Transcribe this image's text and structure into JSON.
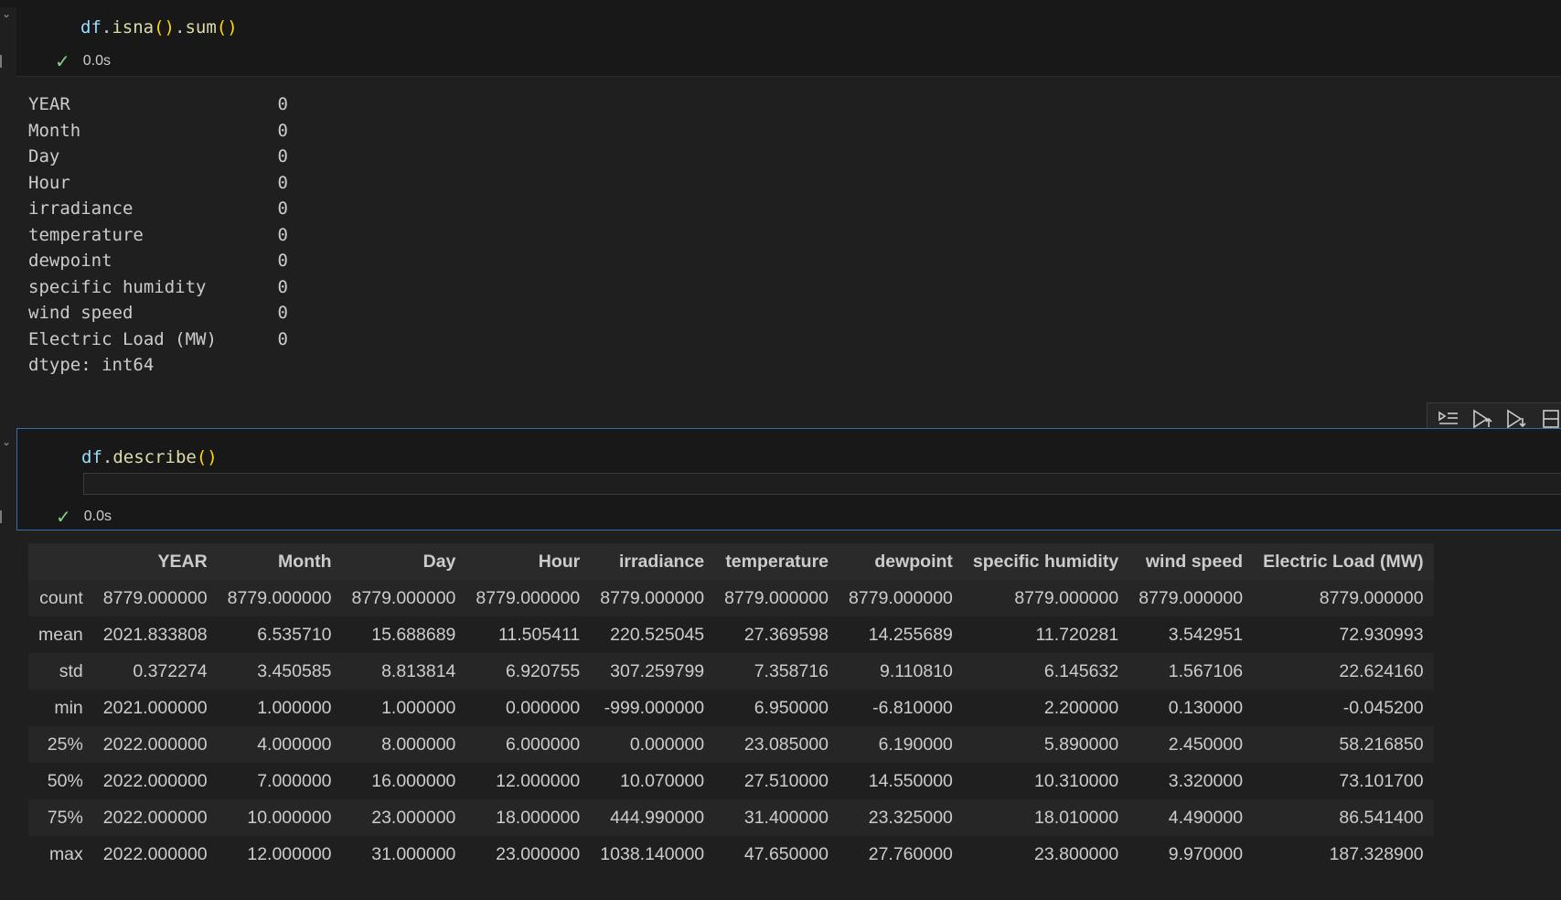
{
  "cell1": {
    "code": {
      "obj": "df",
      "dot1": ".",
      "fn1": "isna",
      "p1": "()",
      "dot2": ".",
      "fn2": "sum",
      "p2": "()"
    },
    "status_time": "0.0s"
  },
  "isna_output": {
    "rows": [
      {
        "name": "YEAR",
        "value": "0"
      },
      {
        "name": "Month",
        "value": "0"
      },
      {
        "name": "Day",
        "value": "0"
      },
      {
        "name": "Hour",
        "value": "0"
      },
      {
        "name": "irradiance",
        "value": "0"
      },
      {
        "name": "temperature",
        "value": "0"
      },
      {
        "name": "dewpoint",
        "value": "0"
      },
      {
        "name": "specific humidity",
        "value": "0"
      },
      {
        "name": "wind speed",
        "value": "0"
      },
      {
        "name": "Electric Load (MW)",
        "value": "0"
      }
    ],
    "dtype_line": "dtype: int64"
  },
  "cell2": {
    "code": {
      "obj": "df",
      "dot1": ".",
      "fn1": "describe",
      "p1": "()"
    },
    "status_time": "0.0s"
  },
  "toolbar": {
    "icons": [
      "run-by-line-icon",
      "execute-above-icon",
      "execute-below-icon",
      "split-cell-icon"
    ]
  },
  "describe_table": {
    "columns": [
      "",
      "YEAR",
      "Month",
      "Day",
      "Hour",
      "irradiance",
      "temperature",
      "dewpoint",
      "specific humidity",
      "wind speed",
      "Electric Load (MW)"
    ],
    "rows": [
      [
        "count",
        "8779.000000",
        "8779.000000",
        "8779.000000",
        "8779.000000",
        "8779.000000",
        "8779.000000",
        "8779.000000",
        "8779.000000",
        "8779.000000",
        "8779.000000"
      ],
      [
        "mean",
        "2021.833808",
        "6.535710",
        "15.688689",
        "11.505411",
        "220.525045",
        "27.369598",
        "14.255689",
        "11.720281",
        "3.542951",
        "72.930993"
      ],
      [
        "std",
        "0.372274",
        "3.450585",
        "8.813814",
        "6.920755",
        "307.259799",
        "7.358716",
        "9.110810",
        "6.145632",
        "1.567106",
        "22.624160"
      ],
      [
        "min",
        "2021.000000",
        "1.000000",
        "1.000000",
        "0.000000",
        "-999.000000",
        "6.950000",
        "-6.810000",
        "2.200000",
        "0.130000",
        "-0.045200"
      ],
      [
        "25%",
        "2022.000000",
        "4.000000",
        "8.000000",
        "6.000000",
        "0.000000",
        "23.085000",
        "6.190000",
        "5.890000",
        "2.450000",
        "58.216850"
      ],
      [
        "50%",
        "2022.000000",
        "7.000000",
        "16.000000",
        "12.000000",
        "10.070000",
        "27.510000",
        "14.550000",
        "10.310000",
        "3.320000",
        "73.101700"
      ],
      [
        "75%",
        "2022.000000",
        "10.000000",
        "23.000000",
        "18.000000",
        "444.990000",
        "31.400000",
        "23.325000",
        "18.010000",
        "4.490000",
        "86.541400"
      ],
      [
        "max",
        "2022.000000",
        "12.000000",
        "31.000000",
        "23.000000",
        "1038.140000",
        "47.650000",
        "27.760000",
        "23.800000",
        "9.970000",
        "187.328900"
      ]
    ]
  }
}
